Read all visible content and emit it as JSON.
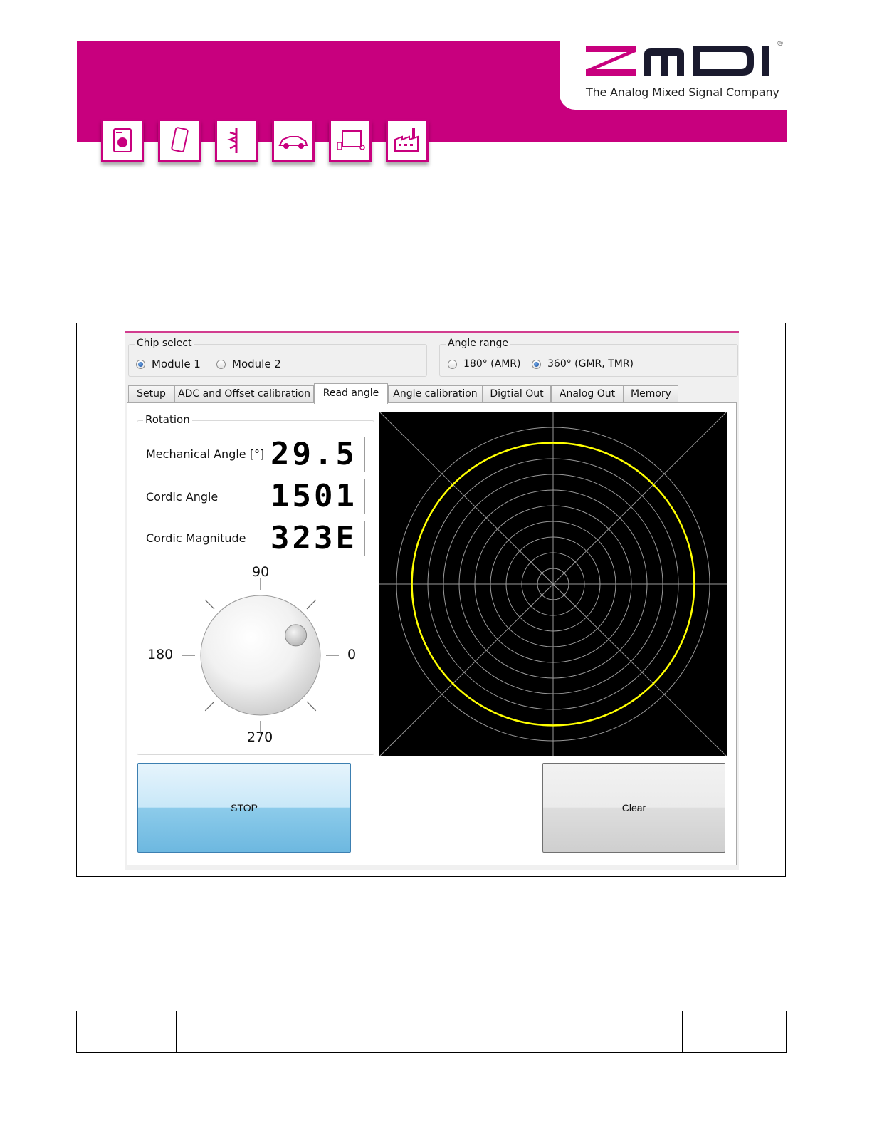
{
  "header": {
    "brand": "ZMDI",
    "registered_mark": "®",
    "tagline": "The Analog Mixed Signal Company",
    "brand_color": "#c8007e",
    "app_icons": [
      "washing-machine-icon",
      "smartphone-icon",
      "medical-icon",
      "car-icon",
      "tv-icon",
      "factory-icon"
    ]
  },
  "chip_select": {
    "title": "Chip select",
    "options": [
      {
        "label": "Module 1",
        "selected": true
      },
      {
        "label": "Module 2",
        "selected": false
      }
    ]
  },
  "angle_range": {
    "title": "Angle range",
    "options": [
      {
        "label": "180° (AMR)",
        "selected": false
      },
      {
        "label": "360° (GMR, TMR)",
        "selected": true
      }
    ]
  },
  "tabs": [
    {
      "label": "Setup",
      "active": false
    },
    {
      "label": "ADC and Offset calibration",
      "active": false
    },
    {
      "label": "Read angle",
      "active": true
    },
    {
      "label": "Angle calibration",
      "active": false
    },
    {
      "label": "Digtial Out",
      "active": false
    },
    {
      "label": "Analog Out",
      "active": false
    },
    {
      "label": "Memory",
      "active": false
    }
  ],
  "rotation": {
    "title": "Rotation",
    "mechanical_angle_label": "Mechanical Angle [°]",
    "mechanical_angle_value": "29.5",
    "cordic_angle_label": "Cordic Angle",
    "cordic_angle_value": "1501",
    "cordic_magnitude_label": "Cordic Magnitude",
    "cordic_magnitude_value": "323E",
    "dial": {
      "labels": {
        "top": "90",
        "left": "180",
        "right": "0",
        "bottom": "270"
      },
      "angle_deg": 29.5
    }
  },
  "polar_plot": {
    "background": "#000000",
    "grid_color": "#9a9a9a",
    "trace_color": "#ffff00",
    "ring_count": 10,
    "trace_radius_fraction": 0.82
  },
  "buttons": {
    "stop": "STOP",
    "clear": "Clear"
  }
}
